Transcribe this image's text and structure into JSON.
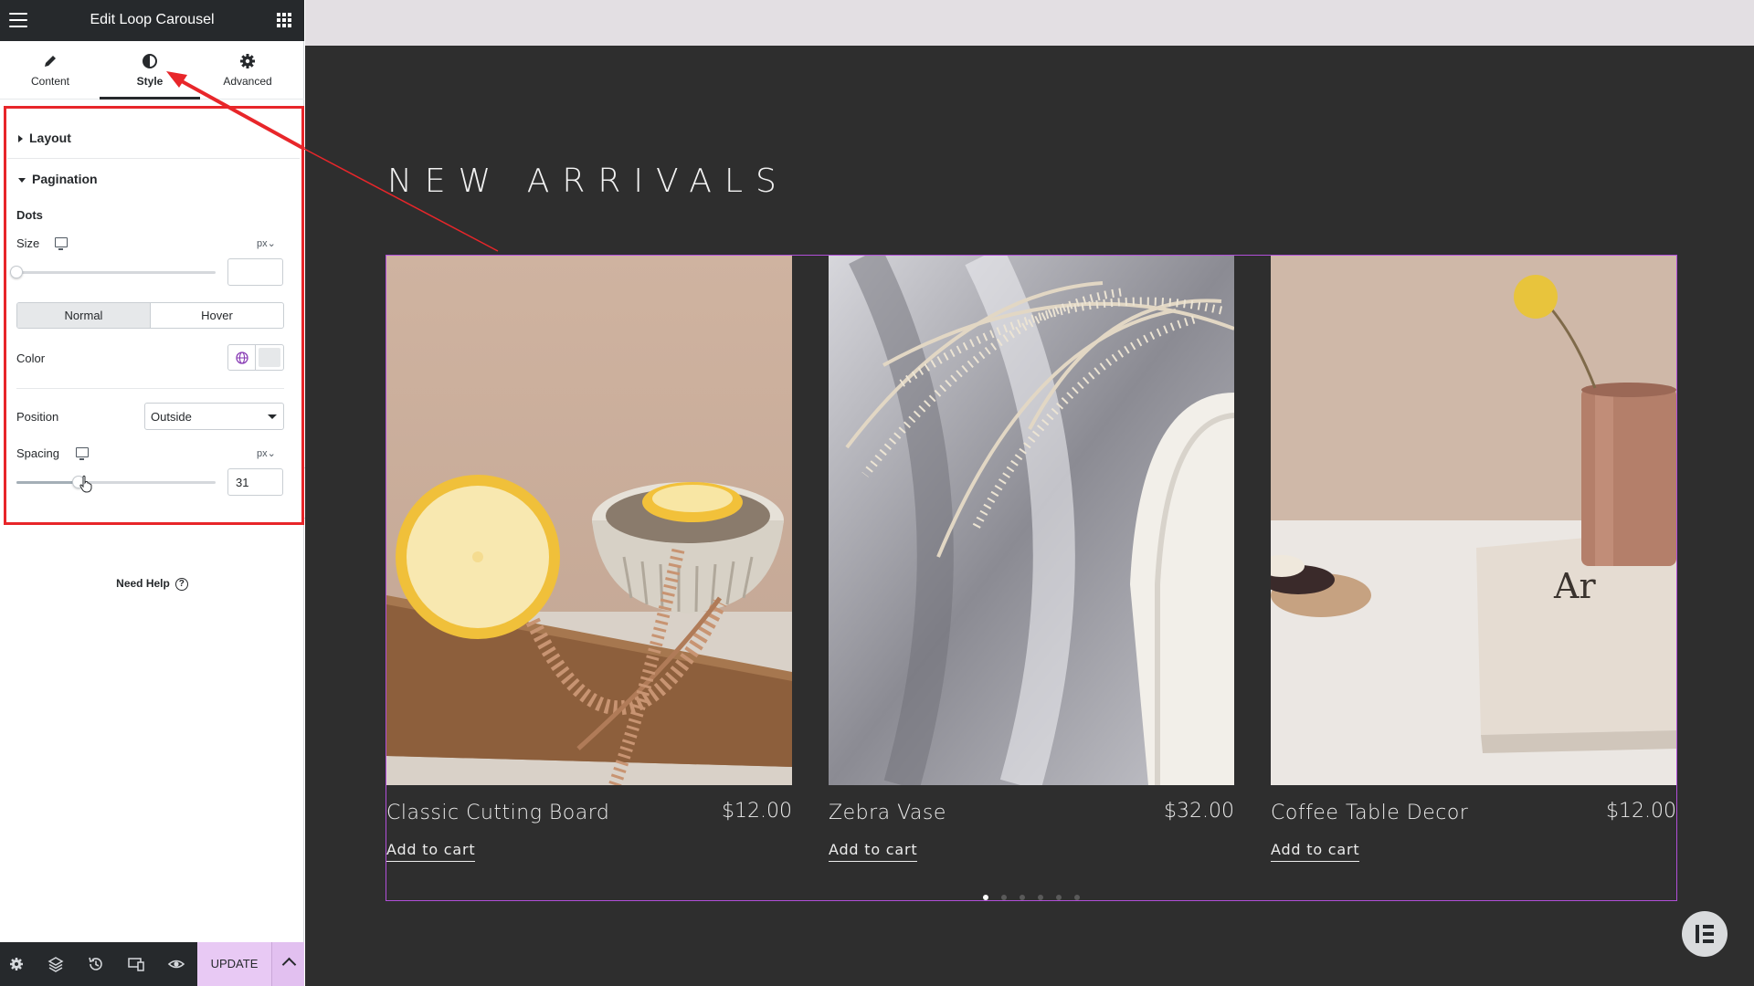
{
  "panel": {
    "title": "Edit Loop Carousel",
    "tabs": [
      {
        "label": "Content",
        "icon": "pencil-icon"
      },
      {
        "label": "Style",
        "icon": "half-circle-icon",
        "active": true
      },
      {
        "label": "Advanced",
        "icon": "gear-icon"
      }
    ],
    "sections": {
      "layout": "Layout",
      "pagination": "Pagination"
    },
    "dots_heading": "Dots",
    "size": {
      "label": "Size",
      "unit": "px⌄",
      "value": "",
      "level": 0
    },
    "state_tabs": {
      "normal": "Normal",
      "hover": "Hover",
      "active": "Normal"
    },
    "color_label": "Color",
    "position": {
      "label": "Position",
      "value": "Outside"
    },
    "spacing": {
      "label": "Spacing",
      "unit": "px⌄",
      "value": "31",
      "level": 0.31
    },
    "need_help": "Need Help",
    "help_icon": "?",
    "update_label": "UPDATE",
    "footer_icons": [
      "settings-icon",
      "layers-icon",
      "history-icon",
      "responsive-icon",
      "preview-eye-icon"
    ]
  },
  "preview": {
    "heading": "NEW ARRIVALS",
    "products": [
      {
        "name": "Classic Cutting Board",
        "price": "$12.00",
        "cta": "Add to cart"
      },
      {
        "name": "Zebra Vase",
        "price": "$32.00",
        "cta": "Add to cart"
      },
      {
        "name": "Coffee Table Decor",
        "price": "$12.00",
        "cta": "Add to cart"
      }
    ],
    "pagination_dots": 6,
    "active_dot": 0
  },
  "colors": {
    "panel_dark": "#26292c",
    "accent_purple": "#b14fd9",
    "highlight_red": "#e8262a",
    "update_bg": "#e8c9f4",
    "canvas_bg": "#2e2e2e"
  }
}
